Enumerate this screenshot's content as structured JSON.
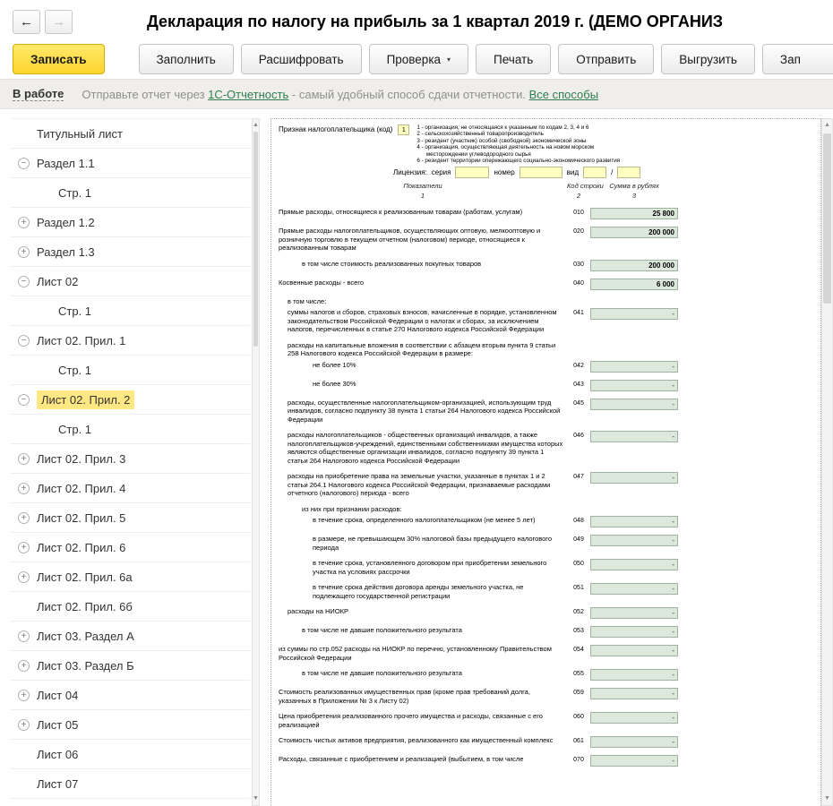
{
  "window": {
    "title": "Декларация по налогу на прибыль за 1 квартал 2019 г. (ДЕМО ОРГАНИЗ"
  },
  "icons": {
    "back": "←",
    "forward": "→",
    "caret": "▾",
    "up": "▲",
    "down": "▼",
    "collapse": "−",
    "expand": "+"
  },
  "colors": {
    "save_button": "#fed42f",
    "selected_item": "#ffe784",
    "link_green": "#2e7d4f",
    "field_bg": "#dde8dd",
    "field_yellow": "#ffffc2"
  },
  "toolbar": {
    "save": "Записать",
    "fill": "Заполнить",
    "decipher": "Расшифровать",
    "check": "Проверка",
    "print": "Печать",
    "send": "Отправить",
    "export": "Выгрузить",
    "truncated": "Зап"
  },
  "statusbar": {
    "status": "В работе",
    "msg_prefix": "Отправьте отчет через ",
    "msg_link1": "1С-Отчетность",
    "msg_mid": " - самый удобный способ сдачи отчетности. ",
    "msg_link2": "Все способы"
  },
  "sidebar": {
    "items": [
      {
        "label": "Титульный лист",
        "expander": "none",
        "child": false
      },
      {
        "label": "Раздел 1.1",
        "expander": "minus",
        "child": false
      },
      {
        "label": "Стр. 1",
        "expander": "none",
        "child": true
      },
      {
        "label": "Раздел 1.2",
        "expander": "plus",
        "child": false
      },
      {
        "label": "Раздел 1.3",
        "expander": "plus",
        "child": false
      },
      {
        "label": "Лист 02",
        "expander": "minus",
        "child": false
      },
      {
        "label": "Стр. 1",
        "expander": "none",
        "child": true
      },
      {
        "label": "Лист 02. Прил. 1",
        "expander": "minus",
        "child": false
      },
      {
        "label": "Стр. 1",
        "expander": "none",
        "child": true
      },
      {
        "label": "Лист 02. Прил. 2",
        "expander": "minus",
        "child": false,
        "selected": true
      },
      {
        "label": "Стр. 1",
        "expander": "none",
        "child": true
      },
      {
        "label": "Лист 02. Прил. 3",
        "expander": "plus",
        "child": false
      },
      {
        "label": "Лист 02. Прил. 4",
        "expander": "plus",
        "child": false
      },
      {
        "label": "Лист 02. Прил. 5",
        "expander": "plus",
        "child": false
      },
      {
        "label": "Лист 02. Прил. 6",
        "expander": "plus",
        "child": false
      },
      {
        "label": "Лист 02. Прил. 6а",
        "expander": "plus",
        "child": false
      },
      {
        "label": "Лист 02. Прил. 6б",
        "expander": "none",
        "child": false
      },
      {
        "label": "Лист 03. Раздел А",
        "expander": "plus",
        "child": false
      },
      {
        "label": "Лист 03. Раздел Б",
        "expander": "plus",
        "child": false
      },
      {
        "label": "Лист 04",
        "expander": "plus",
        "child": false
      },
      {
        "label": "Лист 05",
        "expander": "plus",
        "child": false
      },
      {
        "label": "Лист 06",
        "expander": "none",
        "child": false
      },
      {
        "label": "Лист 07",
        "expander": "none",
        "child": false
      }
    ]
  },
  "form": {
    "taxpayer": {
      "label": "Признак налогоплательщика (код)",
      "value": "1",
      "legend": [
        "1 - организация, не относящаяся к указанным по кодам 2, 3, 4 и 6",
        "2 - сельскохозяйственный товаропроизводитель",
        "3 - резидент (участник) особой (свободной) экономической зоны",
        "4 - организация, осуществляющая деятельность на новом морском",
        "      месторождении углеводородного сырья",
        "6 - резидент территории опережающего социально-экономического развития"
      ]
    },
    "license": {
      "label": "Лицензия:",
      "series": "серия",
      "number": "номер",
      "kind": "вид",
      "slash": "/"
    },
    "columns": {
      "indicators": "Показатели",
      "code": "Код строки",
      "sum": "Сумма в рублях",
      "n1": "1",
      "n2": "2",
      "n3": "3"
    },
    "rows": [
      {
        "indent": 0,
        "label": "Прямые расходы, относящиеся к реализованным товарам (работам, услугам)",
        "code": "010",
        "value": "25 800"
      },
      {
        "indent": 0,
        "label": "Прямые расходы налогоплательщиков, осуществляющих оптовую, мелкооптовую и розничную торговлю в текущем отчетном (налоговом) периоде, относящиеся к реализованным товарам",
        "code": "020",
        "value": "200 000"
      },
      {
        "indent": 2,
        "label": "в том числе стоимость реализованных покупных товаров",
        "code": "030",
        "value": "200 000"
      },
      {
        "indent": 0,
        "label": "Косвенные расходы - всего",
        "code": "040",
        "value": "6 000"
      },
      {
        "indent": 1,
        "label": "в том числе:"
      },
      {
        "indent": 1,
        "label": "суммы налогов и сборов, страховых взносов, начисленные в порядке, установленном законодательством Российской Федерации о налогах и сборах, за исключением налогов, перечисленных в статье 270 Налогового кодекса Российской Федерации",
        "code": "041",
        "value": "-"
      },
      {
        "indent": 1,
        "label": "расходы на капитальные вложения в соответствии с абзацем вторым пункта 9 статьи 258 Налогового кодекса Российской Федерации в размере:"
      },
      {
        "indent": 3,
        "label": "не более 10%",
        "code": "042",
        "value": "-"
      },
      {
        "indent": 3,
        "label": "не более 30%",
        "code": "043",
        "value": "-"
      },
      {
        "indent": 1,
        "label": "расходы, осуществленные налогоплательщиком-организацией, использующим труд инвалидов, согласно подпункту 38 пункта 1 статьи 264 Налогового кодекса Российской Федерации",
        "code": "045",
        "value": "-"
      },
      {
        "indent": 1,
        "label": "расходы налогоплательщиков - общественных организаций инвалидов, а также налогоплательщиков-учреждений, единственными собственниками имущества которых являются общественные организации инвалидов, согласно подпункту 39 пункта 1 статьи 264 Налогового кодекса Российской Федерации",
        "code": "046",
        "value": "-"
      },
      {
        "indent": 1,
        "label": "расходы на приобретение права на земельные участки, указанные в пунктах 1 и 2 статьи 264.1 Налогового кодекса Российской Федерации, признаваемые расходами отчетного (налогового) периода - всего",
        "code": "047",
        "value": "-"
      },
      {
        "indent": 2,
        "label": "из них при признании расходов:"
      },
      {
        "indent": 3,
        "label": "в течение срока, определенного налогоплательщиком (не менее 5 лет)",
        "code": "048",
        "value": "-"
      },
      {
        "indent": 3,
        "label": "в размере, не превышающем 30% налоговой базы предыдущего налогового периода",
        "code": "049",
        "value": "-"
      },
      {
        "indent": 3,
        "label": "в течение срока, установленного договором при приобретении земельного участка на условиях рассрочки",
        "code": "050",
        "value": "-"
      },
      {
        "indent": 3,
        "label": "в течение срока действия договора аренды земельного участка, не подлежащего государственной регистрации",
        "code": "051",
        "value": "-"
      },
      {
        "indent": 1,
        "label": "расходы на НИОКР",
        "code": "052",
        "value": "-"
      },
      {
        "indent": 2,
        "label": "в том числе не давшие положительного результата",
        "code": "053",
        "value": "-"
      },
      {
        "indent": 0,
        "label": "из суммы по стр.052 расходы на НИОКР по перечню, установленному Правительством Российской Федерации",
        "code": "054",
        "value": "-"
      },
      {
        "indent": 2,
        "label": "в том числе не давшие положительного результата",
        "code": "055",
        "value": "-"
      },
      {
        "indent": 0,
        "label": "Стоимость реализованных имущественных прав (кроме прав требований долга, указанных в Приложении № 3 к Листу 02)",
        "code": "059",
        "value": "-"
      },
      {
        "indent": 0,
        "label": "Цена приобретения реализованного прочего имущества и расходы, связанные с его реализацией",
        "code": "060",
        "value": "-"
      },
      {
        "indent": 0,
        "label": "Стоимость чистых активов предприятия, реализованного как имущественный комплекс",
        "code": "061",
        "value": "-"
      },
      {
        "indent": 0,
        "label": "Расходы, связанные с приобретением и реализацией (выбытием, в том числе",
        "code": "070",
        "value": "-"
      }
    ]
  }
}
